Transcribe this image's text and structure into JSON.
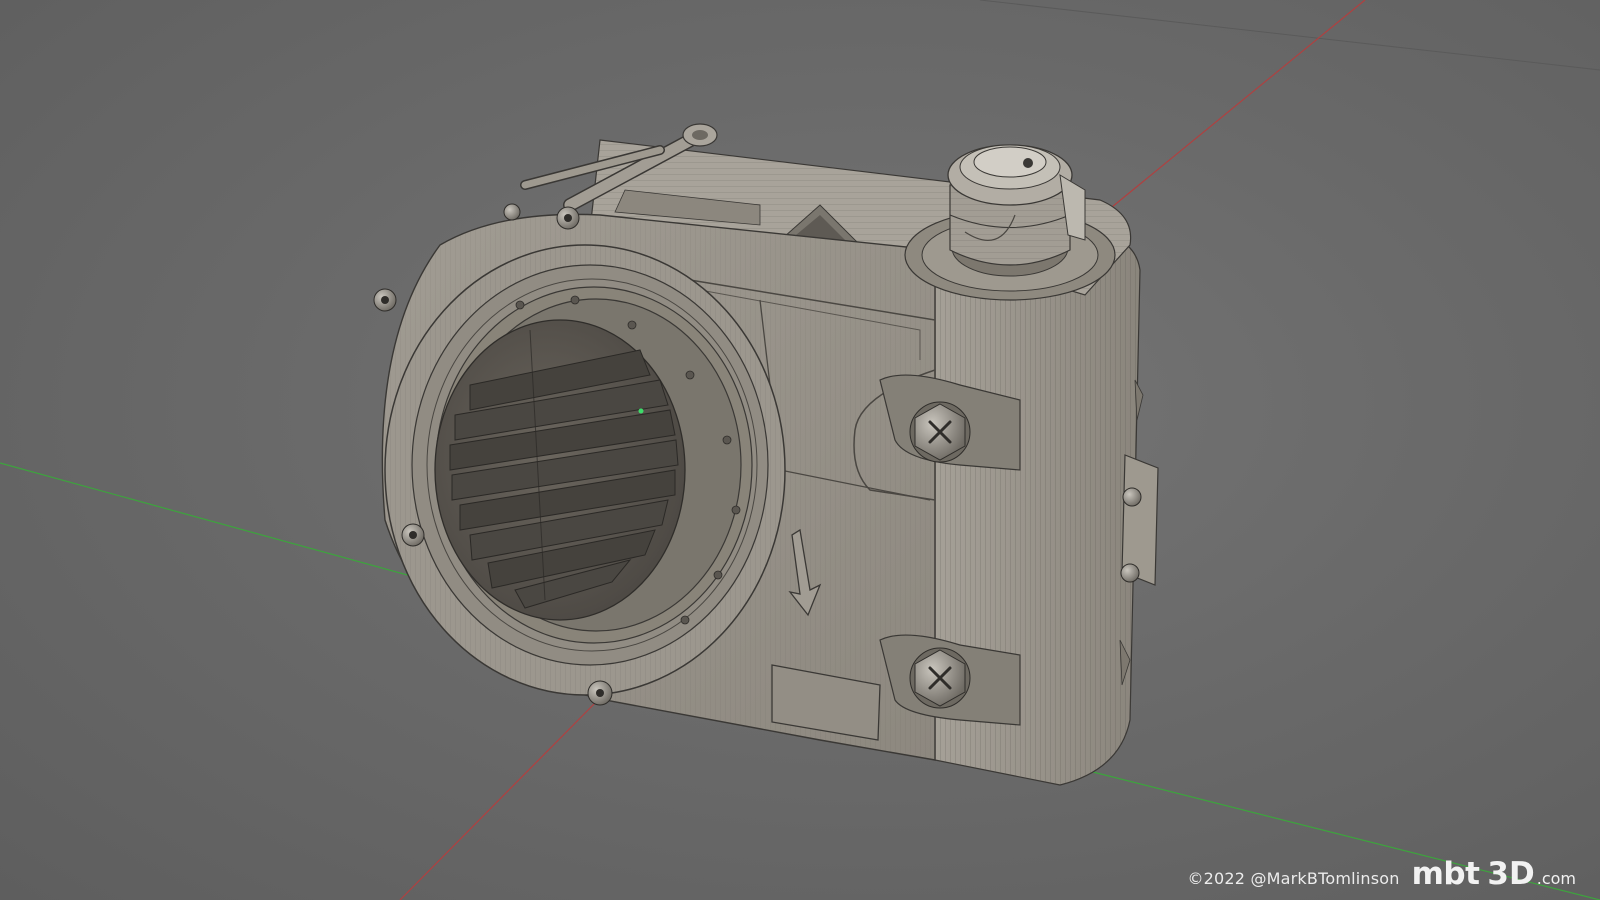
{
  "scene": {
    "subject": "3D wireframe-shaded mechanical device render",
    "background_color": "#6b6b6b",
    "axis_x_color": "#b04040",
    "axis_y_color": "#3da43d",
    "model_color": "#9a958c",
    "wire_color": "#3a3835"
  },
  "watermark": {
    "copyright": "©2022 @MarkBTomlinson",
    "logo_mbt": "mbt",
    "logo_3d": "3D",
    "logo_com": ".com"
  }
}
